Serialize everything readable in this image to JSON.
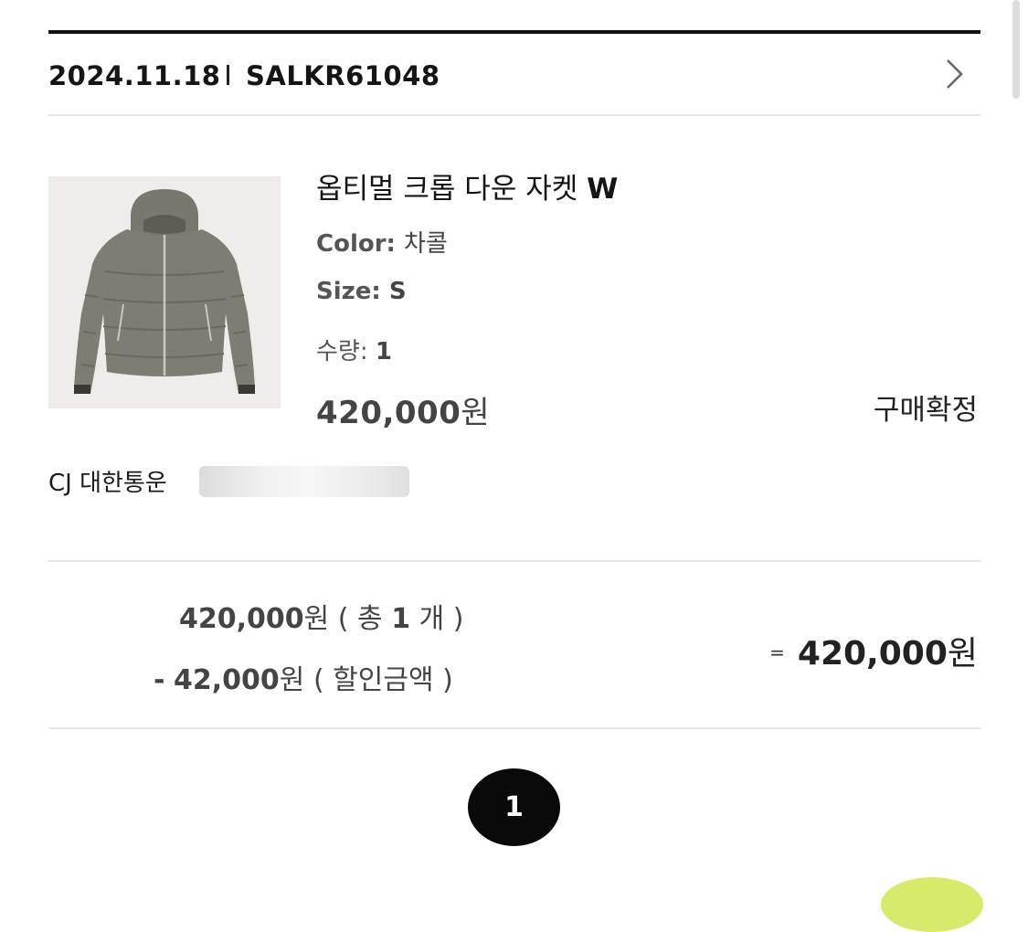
{
  "order": {
    "date": "2024.11.18",
    "number": "SALKR61048"
  },
  "product": {
    "name": "옵티멀 크롭 다운 자켓",
    "name_suffix": "W",
    "color_label": "Color:",
    "color_value": "차콜",
    "size_label": "Size:",
    "size_value": "S",
    "qty_label": "수량:",
    "qty_value": "1",
    "price_amount": "420,000",
    "price_unit": "원",
    "status": "구매확정"
  },
  "shipping": {
    "carrier": "CJ 대한통운"
  },
  "summary": {
    "subtotal_amount": "420,000",
    "subtotal_unit": "원",
    "subtotal_note_open": "( 총",
    "subtotal_count": "1",
    "subtotal_note_close": "개 )",
    "discount_sign": "-",
    "discount_amount": "42,000",
    "discount_unit": "원",
    "discount_note": "( 할인금액 )",
    "total_eq": "=",
    "total_amount": "420,000",
    "total_unit": "원"
  },
  "pagination": {
    "current": "1"
  },
  "icons": {
    "detail": "chevron-right-icon",
    "fab": "floating-action-button"
  },
  "colors": {
    "accent_fab": "#d8ea6a",
    "page_button": "#0a0a0a"
  }
}
